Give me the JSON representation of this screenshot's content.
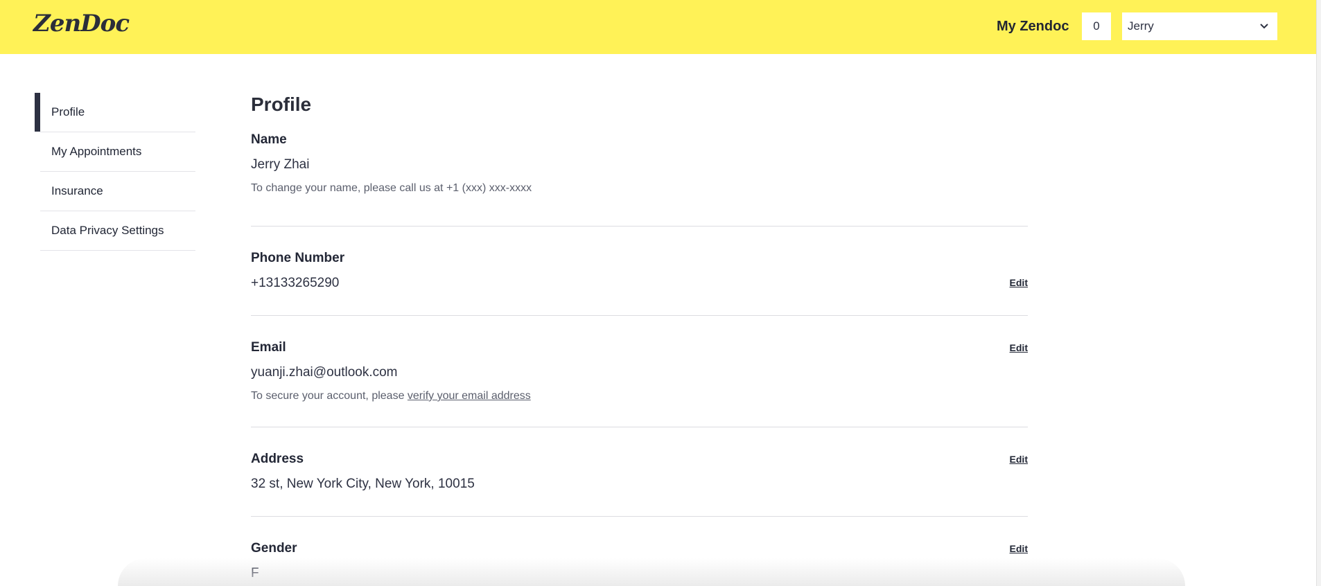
{
  "header": {
    "logo": "ZenDoc",
    "my_zendoc": "My Zendoc",
    "counter": "0",
    "user_select": "Jerry",
    "chevron_icon": "chevron-down-icon",
    "background_color": "#fff257"
  },
  "sidebar": {
    "items": [
      {
        "label": "Profile",
        "active": true
      },
      {
        "label": "My Appointments",
        "active": false
      },
      {
        "label": "Insurance",
        "active": false
      },
      {
        "label": "Data Privacy Settings",
        "active": false
      }
    ]
  },
  "main": {
    "title": "Profile",
    "name": {
      "label": "Name",
      "value": "Jerry Zhai",
      "note": "To change your name, please call us at +1 (xxx) xxx-xxxx"
    },
    "phone": {
      "label": "Phone Number",
      "value": "+13133265290",
      "edit": "Edit"
    },
    "email": {
      "label": "Email",
      "value": "yuanji.zhai@outlook.com",
      "note_prefix": "To secure your account, please ",
      "note_link": "verify your email address",
      "edit": "Edit"
    },
    "address": {
      "label": "Address",
      "value": "32 st, New York City, New York, 10015",
      "edit": "Edit"
    },
    "gender": {
      "label": "Gender",
      "value": "F",
      "edit": "Edit"
    }
  }
}
